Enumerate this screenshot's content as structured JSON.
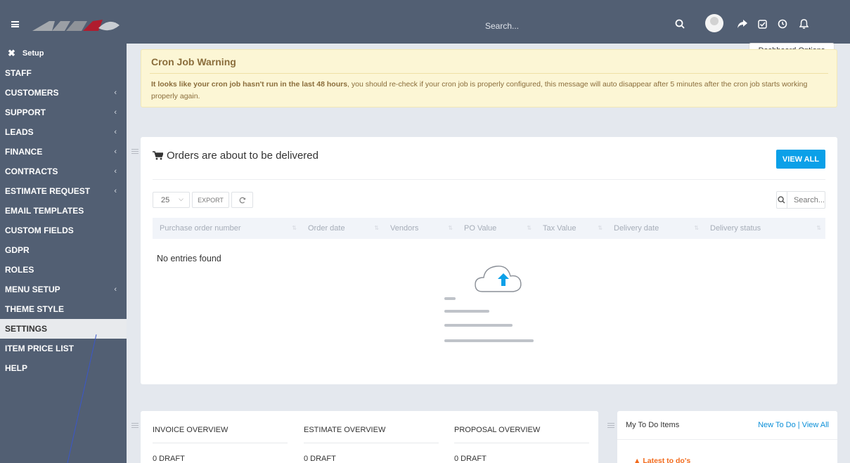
{
  "header": {
    "search_placeholder": "Search...",
    "icons": [
      "menu-icon",
      "search-icon",
      "avatar",
      "share-icon",
      "checkbox-icon",
      "clock-icon",
      "bell-icon"
    ]
  },
  "tooltip": "Dashboard Options",
  "sidebar": {
    "setup_label": "Setup",
    "items": [
      {
        "label": "STAFF",
        "chevron": ""
      },
      {
        "label": "CUSTOMERS",
        "chevron": "‹"
      },
      {
        "label": "SUPPORT",
        "chevron": "‹"
      },
      {
        "label": "LEADS",
        "chevron": "‹"
      },
      {
        "label": "FINANCE",
        "chevron": "‹"
      },
      {
        "label": "CONTRACTS",
        "chevron": "‹"
      },
      {
        "label": "ESTIMATE REQUEST",
        "chevron": "‹"
      },
      {
        "label": "EMAIL TEMPLATES",
        "chevron": ""
      },
      {
        "label": "CUSTOM FIELDS",
        "chevron": ""
      },
      {
        "label": "GDPR",
        "chevron": ""
      },
      {
        "label": "ROLES",
        "chevron": ""
      },
      {
        "label": "MENU SETUP",
        "chevron": "‹"
      },
      {
        "label": "THEME STYLE",
        "chevron": ""
      },
      {
        "label": "SETTINGS",
        "chevron": "",
        "active": true
      },
      {
        "label": "ITEM PRICE LIST",
        "chevron": ""
      },
      {
        "label": "HELP",
        "chevron": ""
      }
    ]
  },
  "warning": {
    "title": "Cron Job Warning",
    "bold": "It looks like your cron job hasn't run in the last 48 hours",
    "rest": ", you should re-check if your cron job is properly configured, this message will auto disappear after 5 minutes after the cron job starts working properly again."
  },
  "orders": {
    "title": "Orders are about to be delivered",
    "view_all": "VIEW ALL",
    "page_length": "25",
    "export_label": "EXPORT",
    "search_placeholder": "Search...",
    "columns": [
      "Purchase order number",
      "Order date",
      "Vendors",
      "PO Value",
      "Tax Value",
      "Delivery date",
      "Delivery status"
    ],
    "empty_text": "No entries found"
  },
  "overview": [
    {
      "title": "INVOICE OVERVIEW",
      "value": "0 DRAFT"
    },
    {
      "title": "ESTIMATE OVERVIEW",
      "value": "0 DRAFT"
    },
    {
      "title": "PROPOSAL OVERVIEW",
      "value": "0 DRAFT"
    }
  ],
  "todo": {
    "title": "My To Do Items",
    "new_link": "New To Do",
    "view_all_link": "| View All",
    "latest": "Latest to do's"
  },
  "colors": {
    "sidebar_bg": "#525f73",
    "accent": "#0ba0e8",
    "warning_bg": "#fcf6d5",
    "warning_text": "#8a6d3b",
    "todo_orange": "#f26b1d"
  }
}
